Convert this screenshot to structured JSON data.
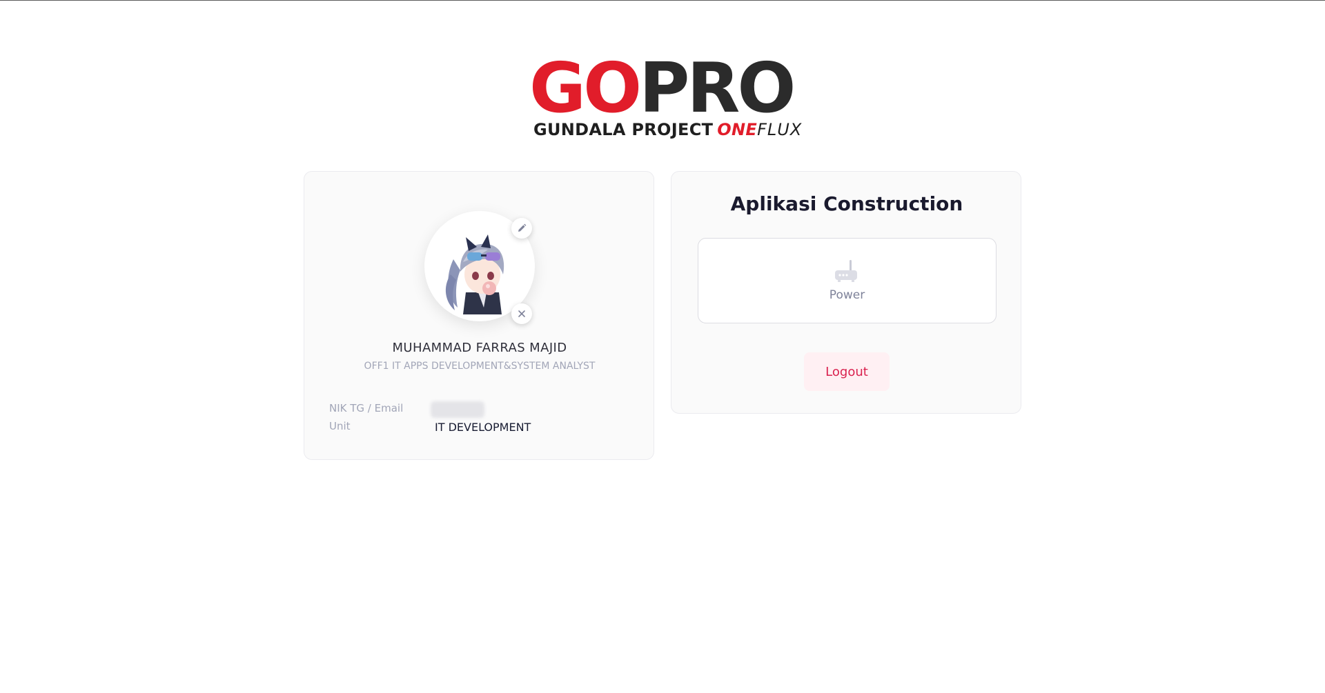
{
  "logo": {
    "main_part1": "GO",
    "main_part2": "PRO",
    "sub_part1": "GUNDALA PROJECT",
    "sub_part2": "ONE",
    "sub_part3": "FLUX"
  },
  "profile": {
    "name": "MUHAMMAD FARRAS MAJID",
    "title": "OFF1 IT APPS DEVELOPMENT&SYSTEM ANALYST",
    "nik_label": "NIK TG / Email",
    "unit_label": "Unit",
    "unit_value": "IT DEVELOPMENT",
    "edit_icon": "pencil-icon",
    "remove_icon": "close-icon"
  },
  "apps": {
    "title": "Aplikasi Construction",
    "items": [
      {
        "label": "Power",
        "icon": "router-icon"
      }
    ],
    "logout_label": "Logout"
  },
  "colors": {
    "brand_red": "#e11d2a",
    "logo_dark": "#2b2b2b",
    "logout_text": "#d9214e",
    "logout_bg": "#fff0f3",
    "muted": "#a1a5b7"
  }
}
